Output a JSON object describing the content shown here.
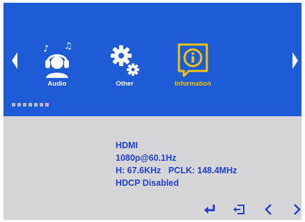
{
  "menu": {
    "tabs": [
      {
        "label": "Audio",
        "icon": "headphones-person-icon",
        "selected": false
      },
      {
        "label": "Other",
        "icon": "gears-icon",
        "selected": false
      },
      {
        "label": "Information",
        "icon": "info-bubble-icon",
        "selected": true
      }
    ],
    "page_indicator": {
      "count": 7,
      "active_index": 6
    }
  },
  "information": {
    "lines": [
      "HDMI",
      "1080p@60.1Hz",
      "H: 67.6KHz   PCLK: 148.4MHz",
      "HDCP Disabled"
    ]
  },
  "nav_buttons": [
    {
      "name": "enter",
      "icon": "enter-icon"
    },
    {
      "name": "exit",
      "icon": "exit-icon"
    },
    {
      "name": "previous",
      "icon": "chevron-left-icon"
    },
    {
      "name": "next",
      "icon": "chevron-right-icon"
    }
  ],
  "colors": {
    "menu_background": "#1e5bd6",
    "panel_background": "#d6d6d8",
    "info_text": "#1e3fd0",
    "selected_label": "#f7c400",
    "active_dot": "#f0a0e0"
  }
}
